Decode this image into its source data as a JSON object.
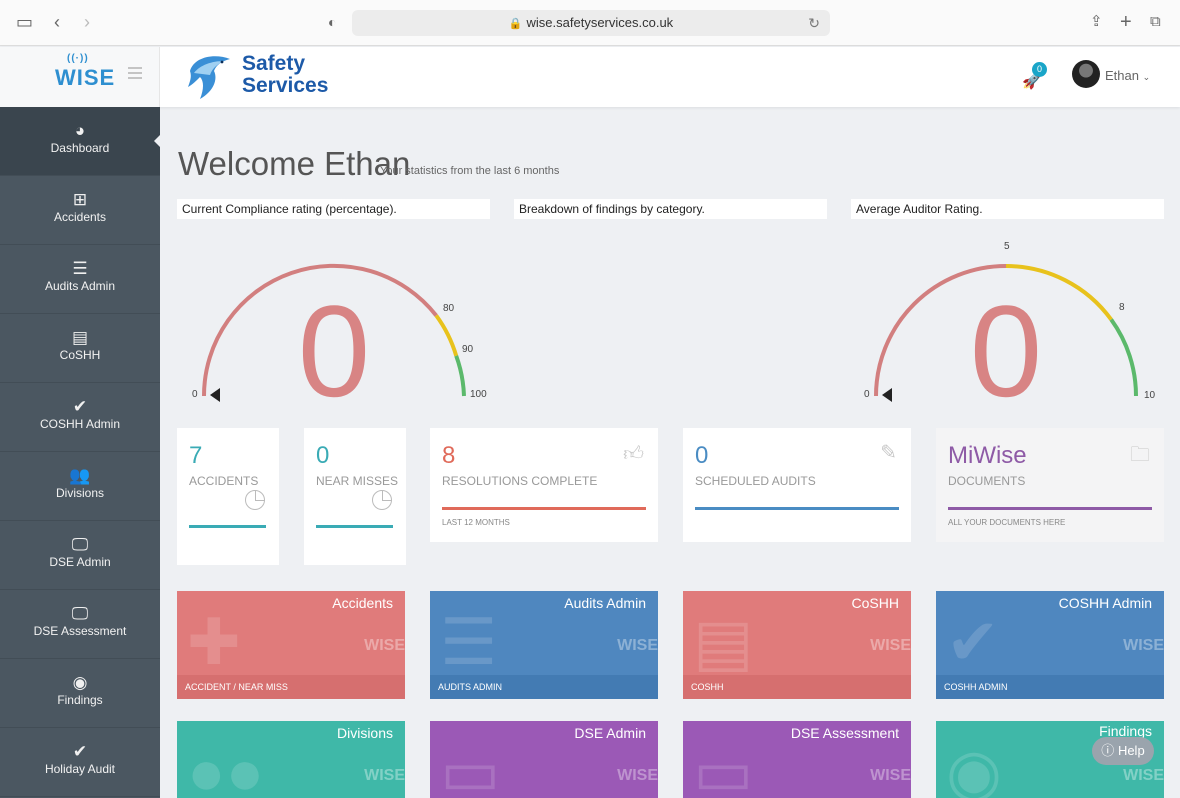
{
  "browser": {
    "url": "wise.safetyservices.co.uk"
  },
  "header": {
    "logo_text": "WISE",
    "brand_line1": "Safety",
    "brand_line2": "Services",
    "notification_count": "0",
    "user_name": "Ethan"
  },
  "sidebar": {
    "items": [
      {
        "label": "Dashboard",
        "icon": "dashboard-icon"
      },
      {
        "label": "Accidents",
        "icon": "medkit-icon"
      },
      {
        "label": "Audits Admin",
        "icon": "list-icon"
      },
      {
        "label": "CoSHH",
        "icon": "book-icon"
      },
      {
        "label": "COSHH Admin",
        "icon": "check-icon"
      },
      {
        "label": "Divisions",
        "icon": "users-icon"
      },
      {
        "label": "DSE Admin",
        "icon": "monitor-icon"
      },
      {
        "label": "DSE Assessment",
        "icon": "monitor-icon"
      },
      {
        "label": "Findings",
        "icon": "eye-icon"
      },
      {
        "label": "Holiday Audit",
        "icon": "check-icon"
      }
    ]
  },
  "welcome": {
    "title": "Welcome Ethan",
    "subtitle": "Your statistics from the last 6 months"
  },
  "panels": {
    "compliance_title": "Current Compliance rating (percentage).",
    "findings_title": "Breakdown of findings by category.",
    "auditor_title": "Average Auditor Rating."
  },
  "gauges": {
    "compliance": {
      "value": "0",
      "ticks": [
        "0",
        "80",
        "90",
        "100"
      ]
    },
    "auditor": {
      "value": "0",
      "ticks": [
        "0",
        "5",
        "8",
        "10"
      ]
    }
  },
  "stats": {
    "accidents": {
      "value": "7",
      "label": "ACCIDENTS"
    },
    "near_misses": {
      "value": "0",
      "label": "NEAR MISSES"
    },
    "resolutions": {
      "value": "8",
      "label": "RESOLUTIONS COMPLETE",
      "sub": "LAST 12 MONTHS"
    },
    "scheduled": {
      "value": "0",
      "label": "SCHEDULED AUDITS"
    },
    "documents": {
      "value": "MiWise",
      "label": "DOCUMENTS",
      "sub": "ALL YOUR DOCUMENTS HERE"
    }
  },
  "colors": {
    "red": "#e07b7b",
    "blue": "#4f87bf",
    "teal": "#3fb8a8",
    "purple": "#9b59b6",
    "sidebar": "#4b5761"
  },
  "tiles": [
    {
      "title": "Accidents",
      "footer": "ACCIDENT / NEAR MISS"
    },
    {
      "title": "Audits Admin",
      "footer": "AUDITS ADMIN"
    },
    {
      "title": "CoSHH",
      "footer": "COSHH"
    },
    {
      "title": "COSHH Admin",
      "footer": "COSHH ADMIN"
    },
    {
      "title": "Divisions",
      "footer": ""
    },
    {
      "title": "DSE Admin",
      "footer": ""
    },
    {
      "title": "DSE Assessment",
      "footer": ""
    },
    {
      "title": "Findings",
      "footer": ""
    }
  ],
  "tile_watermark": "WISE",
  "help": {
    "label": "Help"
  }
}
